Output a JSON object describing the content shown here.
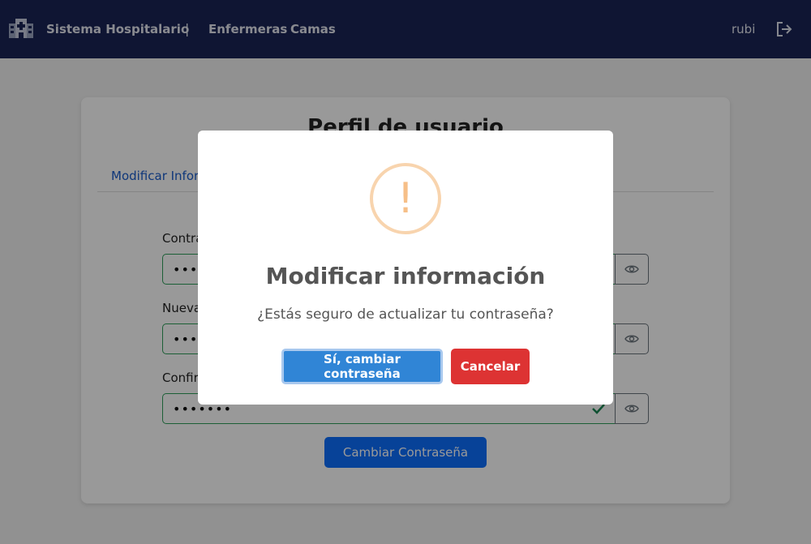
{
  "navbar": {
    "brand": "Sistema Hospitalario",
    "separator": "|",
    "links": [
      "Enfermeras",
      "Camas"
    ],
    "user": "rubi",
    "brand_icon": "hospital-icon",
    "logout_icon": "logout-icon"
  },
  "card": {
    "title": "Perfil de usuario",
    "tab": "Modificar Información",
    "fields": [
      {
        "label": "Contraseña actual",
        "value": "••••"
      },
      {
        "label": "Nueva contraseña",
        "value": "•••••••"
      },
      {
        "label": "Confirmar contraseña",
        "value": "•••••••"
      }
    ],
    "eye_icon": "eye-icon",
    "check_icon": "check-icon",
    "submit_label": "Cambiar Contraseña"
  },
  "modal": {
    "icon": "!",
    "title": "Modificar información",
    "text": "¿Estás seguro de actualizar tu contraseña?",
    "confirm_label": "Sí, cambiar contraseña",
    "cancel_label": "Cancelar"
  },
  "colors": {
    "navbar": "#1a2456",
    "primary": "#0d6efd",
    "confirm": "#3085d6",
    "cancel": "#dd3333",
    "warning": "#f8bb86",
    "valid": "#198754"
  }
}
